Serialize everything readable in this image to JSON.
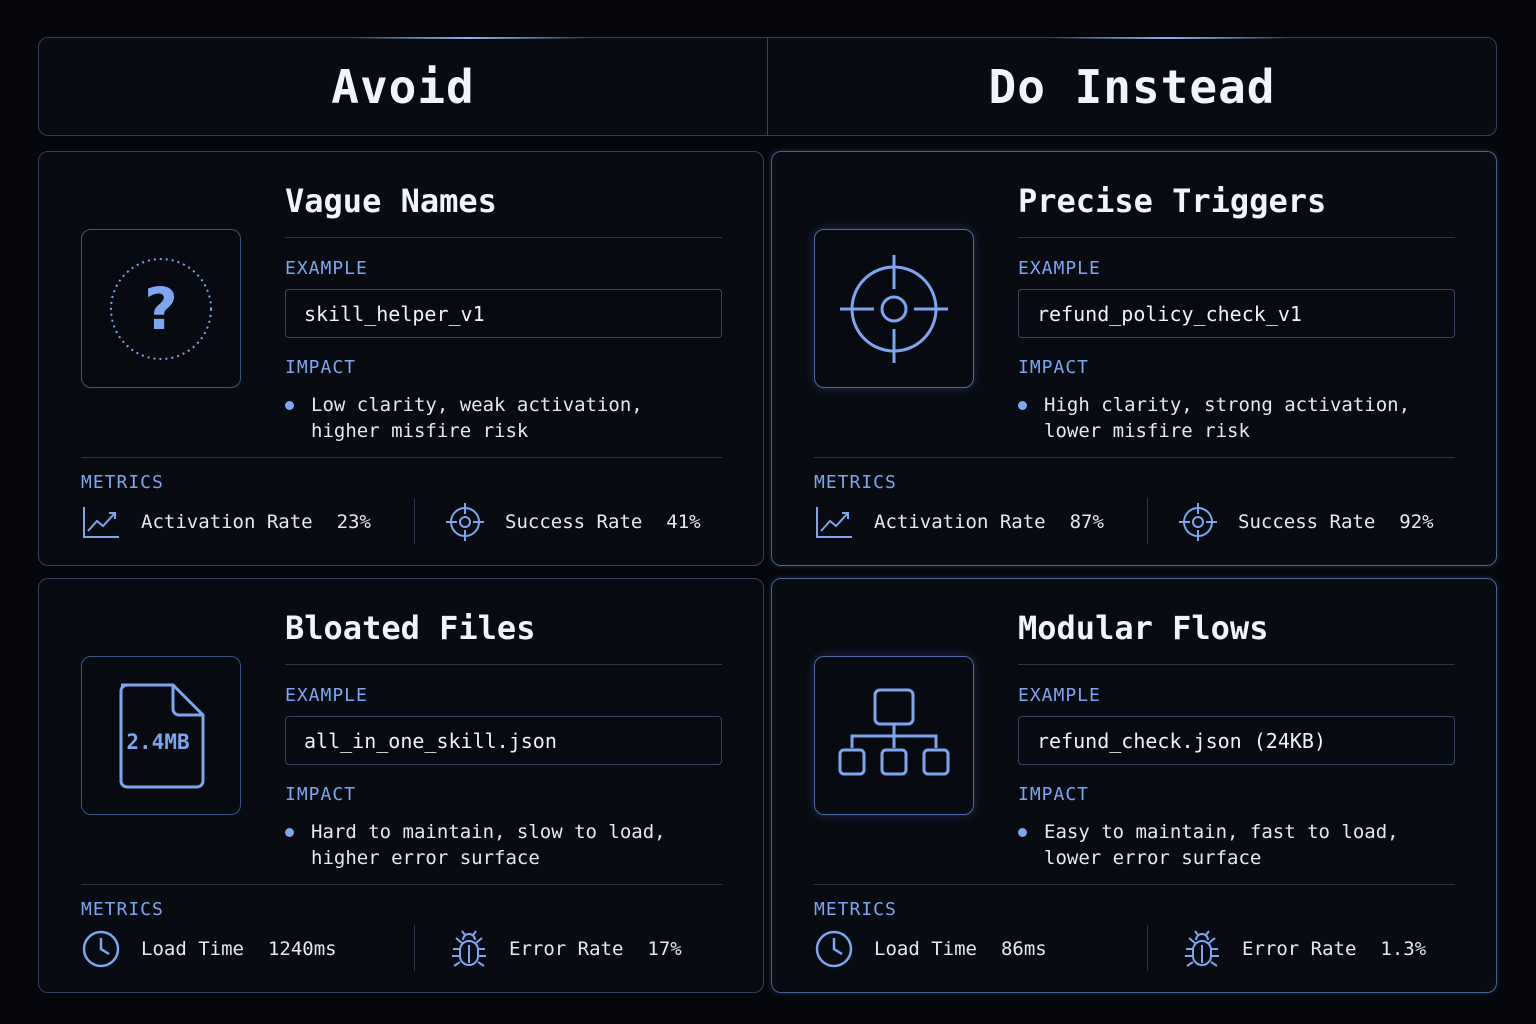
{
  "header": {
    "avoid_title": "Avoid",
    "do_title": "Do Instead"
  },
  "labels": {
    "example": "EXAMPLE",
    "impact": "IMPACT",
    "metrics": "METRICS"
  },
  "colors": {
    "accent": "#7ea6f0",
    "border": "#34415d",
    "background": "#05070c",
    "panel": "#080b12"
  },
  "cards": [
    {
      "title": "Vague Names",
      "icon": "question-icon",
      "example": "skill_helper_v1",
      "impact": "Low clarity, weak activation,\nhigher misfire risk",
      "metric_a": {
        "icon": "trend-chart-icon",
        "name": "Activation Rate",
        "value": "23%"
      },
      "metric_b": {
        "icon": "target-icon",
        "name": "Success Rate",
        "value": "41%"
      }
    },
    {
      "title": "Precise Triggers",
      "icon": "crosshair-icon",
      "example": "refund_policy_check_v1",
      "impact": "High clarity, strong activation,\nlower misfire risk",
      "metric_a": {
        "icon": "trend-chart-icon",
        "name": "Activation Rate",
        "value": "87%"
      },
      "metric_b": {
        "icon": "target-icon",
        "name": "Success Rate",
        "value": "92%"
      }
    },
    {
      "title": "Bloated Files",
      "icon": "file-icon",
      "icon_text": "2.4MB",
      "example": "all_in_one_skill.json",
      "impact": "Hard to maintain, slow to load,\nhigher error surface",
      "metric_a": {
        "icon": "clock-icon",
        "name": "Load Time",
        "value": "1240ms"
      },
      "metric_b": {
        "icon": "bug-icon",
        "name": "Error Rate",
        "value": "17%"
      }
    },
    {
      "title": "Modular Flows",
      "icon": "hierarchy-icon",
      "example": "refund_check.json (24KB)",
      "impact": "Easy to maintain, fast to load,\nlower error surface",
      "metric_a": {
        "icon": "clock-icon",
        "name": "Load Time",
        "value": "86ms"
      },
      "metric_b": {
        "icon": "bug-icon",
        "name": "Error Rate",
        "value": "1.3%"
      }
    }
  ]
}
